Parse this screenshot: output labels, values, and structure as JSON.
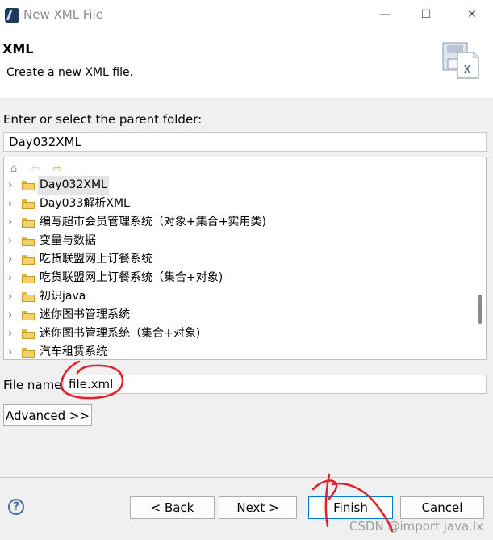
{
  "window": {
    "title": "New XML File",
    "minimize_glyph": "—",
    "maximize_glyph": "☐",
    "close_glyph": "✕"
  },
  "banner": {
    "title": "XML",
    "description": "Create a new XML file.",
    "icon": "xml-file-icon"
  },
  "parent_folder": {
    "label": "Enter or select the parent folder:",
    "value": "Day032XML"
  },
  "tree_toolbar": {
    "home_glyph": "⌂",
    "back_glyph": "⇦",
    "forward_glyph": "⇨"
  },
  "tree": {
    "chevron_glyph": "›",
    "items": [
      {
        "label": "Day032XML",
        "selected": true
      },
      {
        "label": "Day033解析XML"
      },
      {
        "label": "编写超市会员管理系统（对象+集合+实用类)"
      },
      {
        "label": "变量与数据"
      },
      {
        "label": "吃货联盟网上订餐系统"
      },
      {
        "label": "吃货联盟网上订餐系统（集合+对象)"
      },
      {
        "label": "初识java"
      },
      {
        "label": "迷你图书管理系统"
      },
      {
        "label": "迷你图书管理系统（集合+对象)"
      },
      {
        "label": "汽车租赁系统"
      }
    ]
  },
  "file_name": {
    "label": "File name:",
    "value": "file.xml"
  },
  "buttons": {
    "advanced": "Advanced >>",
    "back": "< Back",
    "next": "Next >",
    "finish": "Finish",
    "cancel": "Cancel",
    "help_glyph": "?"
  },
  "watermark": "CSDN @import java.lx",
  "colors": {
    "annotation_red": "#e0202a",
    "focus_blue": "#0078d7"
  }
}
